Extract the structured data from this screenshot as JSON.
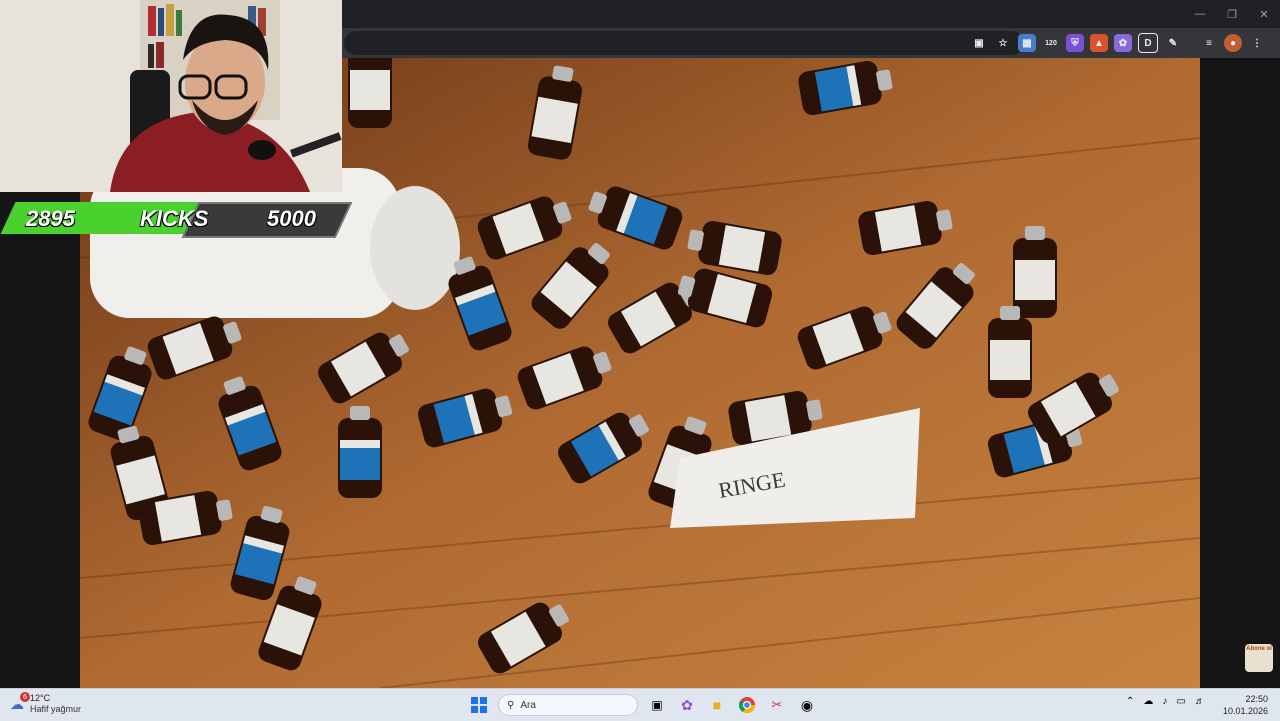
{
  "stream": {
    "kicks_current": "2895",
    "kicks_label": "KICKS",
    "kicks_goal": "5000",
    "kicks_progress": 0.579
  },
  "browser": {
    "extensions": [
      "translate-icon",
      "counter-icon",
      "shield-icon",
      "fox-icon",
      "extension-icon",
      "d-icon",
      "puzzle-icon"
    ],
    "extension_badge": "120"
  },
  "overlay": {
    "abone_text": "Abone ol"
  },
  "taskbar": {
    "weather_badge": "6",
    "weather_temp": "12°C",
    "weather_desc": "Hafif yağmur",
    "search_placeholder": "Ara",
    "time": "22:50",
    "date": "10.01.2026"
  }
}
